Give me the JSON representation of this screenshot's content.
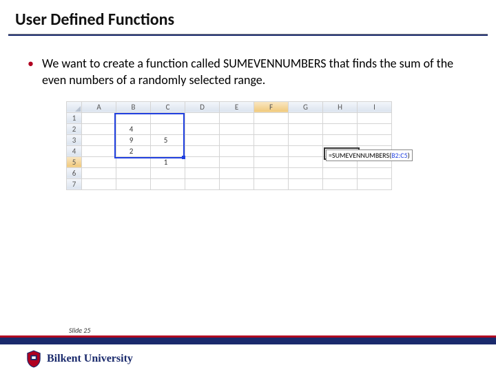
{
  "title": "User Defined Functions",
  "bullet": "•",
  "body": "We want to create a function called SUMEVENNUMBERS that finds the sum of the even numbers of a randomly selected range.",
  "excel": {
    "columns": [
      "A",
      "B",
      "C",
      "D",
      "E",
      "F",
      "G",
      "H",
      "I"
    ],
    "rows": [
      "1",
      "2",
      "3",
      "4",
      "5",
      "6",
      "7"
    ],
    "cells": {
      "B2": "4",
      "B3": "9",
      "B4": "2",
      "C3": "5",
      "C5": "1"
    },
    "formula": {
      "eq": "=",
      "fn": "SUMEVENNUMBERS(",
      "range": "B2:C5",
      "close": ")"
    }
  },
  "slide_label": "Slide 25",
  "university": "Bilkent University"
}
